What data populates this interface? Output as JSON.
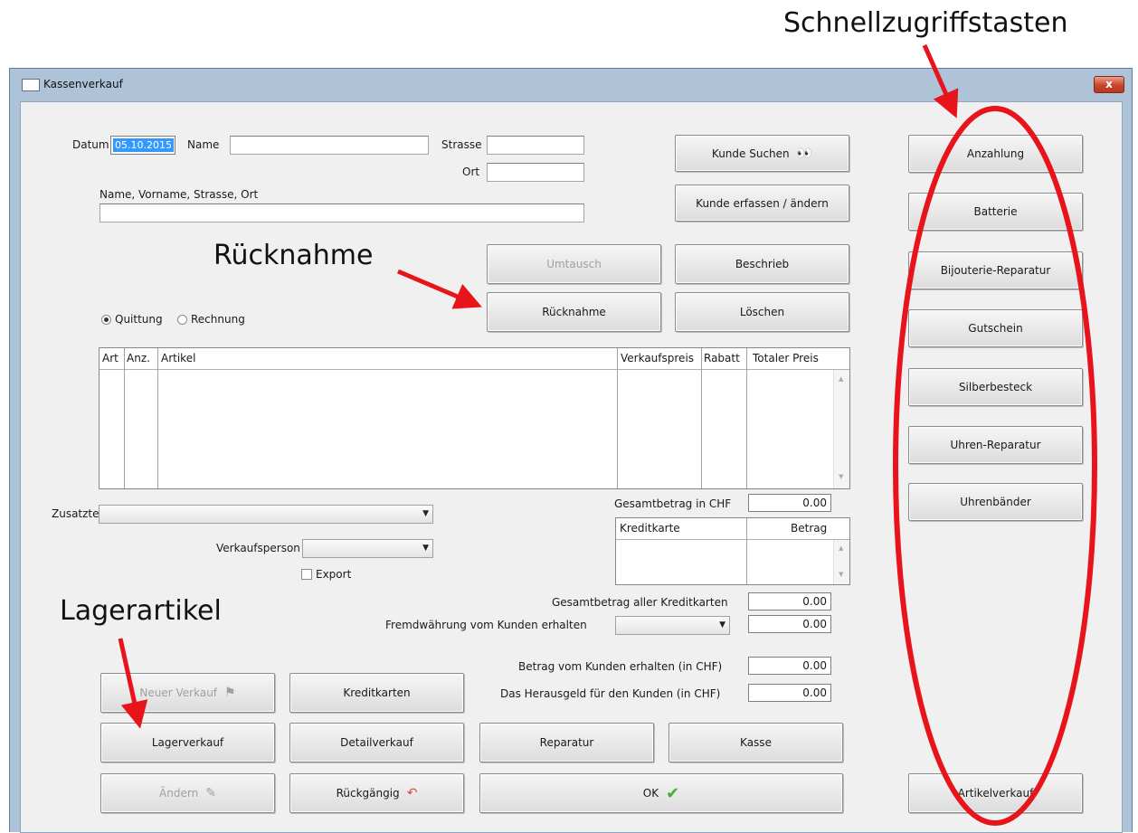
{
  "annotations": {
    "quick_access": "Schnellzugriffstasten",
    "return": "Rücknahme",
    "stock_article": "Lagerartikel"
  },
  "window": {
    "title": "Kassenverkauf",
    "close_label": "x"
  },
  "header": {
    "datum_label": "Datum",
    "datum_value": "05.10.2015",
    "name_label": "Name",
    "name_value": "",
    "strasse_label": "Strasse",
    "strasse_value": "",
    "ort_label": "Ort",
    "ort_value": "",
    "combined_label": "Name, Vorname, Strasse, Ort",
    "combined_value": ""
  },
  "buttons": {
    "kunde_suchen": "Kunde Suchen",
    "kunde_erfassen": "Kunde erfassen / ändern",
    "umtausch": "Umtausch",
    "beschrieb": "Beschrieb",
    "ruecknahme": "Rücknahme",
    "loeschen": "Löschen",
    "neuer_verkauf": "Neuer Verkauf",
    "kreditkarten": "Kreditkarten",
    "lagerverkauf": "Lagerverkauf",
    "detailverkauf": "Detailverkauf",
    "reparatur": "Reparatur",
    "kasse": "Kasse",
    "aendern": "Ändern",
    "rueckgaengig": "Rückgängig",
    "ok": "OK",
    "artikelverkauf": "Artikelverkauf"
  },
  "quick_buttons": [
    "Anzahlung",
    "Batterie",
    "Bijouterie-Reparatur",
    "Gutschein",
    "Silberbesteck",
    "Uhren-Reparatur",
    "Uhrenbänder"
  ],
  "receipt_type": {
    "quittung": "Quittung",
    "rechnung": "Rechnung",
    "selected": "Quittung"
  },
  "article_table": {
    "columns": [
      "Art",
      "Anz.",
      "Artikel",
      "Verkaufspreis",
      "Rabatt",
      "Totaler Preis"
    ],
    "rows": []
  },
  "totals": {
    "gesamtbetrag_label": "Gesamtbetrag in CHF",
    "gesamtbetrag_value": "0.00",
    "kredit_total_label": "Gesamtbetrag aller Kreditkarten",
    "kredit_total_value": "0.00",
    "fremd_label": "Fremdwährung vom Kunden erhalten",
    "fremd_currency": "",
    "fremd_value": "0.00",
    "erhalten_label": "Betrag vom Kunden erhalten (in CHF)",
    "erhalten_value": "0.00",
    "herausgeld_label": "Das Herausgeld für den Kunden (in CHF)",
    "herausgeld_value": "0.00"
  },
  "credit_table": {
    "columns": [
      "Kreditkarte",
      "Betrag"
    ],
    "rows": []
  },
  "extras": {
    "zusatztext_label": "Zusatztext",
    "zusatztext_value": "",
    "verkaufsperson_label": "Verkaufsperson",
    "verkaufsperson_value": "",
    "export_label": "Export"
  },
  "colors": {
    "annotation_red": "#e8141b",
    "titlebar": "#aec3d8",
    "ok_check": "#3fb22f"
  }
}
